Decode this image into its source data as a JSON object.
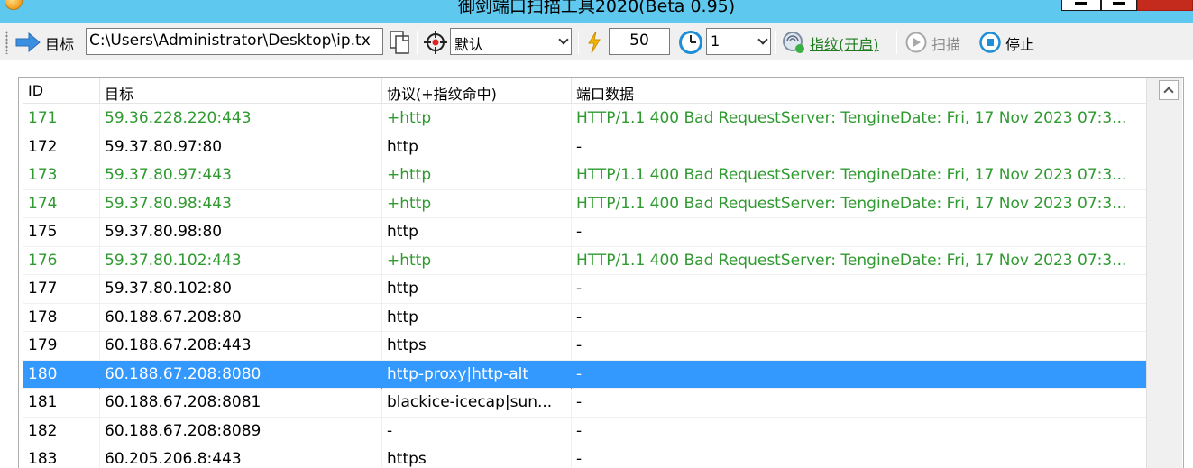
{
  "window": {
    "title": "御剑端口扫描工具2020(Beta 0.95)"
  },
  "toolbar": {
    "target_label": "目标",
    "target_path": "C:\\Users\\Administrator\\Desktop\\ip.tx",
    "profile_selected": "默认",
    "threads_value": "50",
    "timeout_selected": "1",
    "fingerprint_label": "指纹(开启)",
    "scan_label": "扫描",
    "stop_label": "停止"
  },
  "colors": {
    "hit_text": "#2f9a2f",
    "selection": "#3399ff",
    "titlebar": "#5ec8ee"
  },
  "table": {
    "columns": [
      "ID",
      "目标",
      "协议(+指纹命中)",
      "端口数据"
    ],
    "rows": [
      {
        "id": "171",
        "target": "59.36.228.220:443",
        "protocol": "+http",
        "data": "HTTP/1.1 400 Bad RequestServer: TengineDate: Fri, 17 Nov 2023 07:3...",
        "hit": true
      },
      {
        "id": "172",
        "target": "59.37.80.97:80",
        "protocol": "http",
        "data": "-",
        "hit": false
      },
      {
        "id": "173",
        "target": "59.37.80.97:443",
        "protocol": "+http",
        "data": "HTTP/1.1 400 Bad RequestServer: TengineDate: Fri, 17 Nov 2023 07:3...",
        "hit": true
      },
      {
        "id": "174",
        "target": "59.37.80.98:443",
        "protocol": "+http",
        "data": "HTTP/1.1 400 Bad RequestServer: TengineDate: Fri, 17 Nov 2023 07:3...",
        "hit": true
      },
      {
        "id": "175",
        "target": "59.37.80.98:80",
        "protocol": "http",
        "data": "-",
        "hit": false
      },
      {
        "id": "176",
        "target": "59.37.80.102:443",
        "protocol": "+http",
        "data": "HTTP/1.1 400 Bad RequestServer: TengineDate: Fri, 17 Nov 2023 07:3...",
        "hit": true
      },
      {
        "id": "177",
        "target": "59.37.80.102:80",
        "protocol": "http",
        "data": "-",
        "hit": false
      },
      {
        "id": "178",
        "target": "60.188.67.208:80",
        "protocol": "http",
        "data": "-",
        "hit": false
      },
      {
        "id": "179",
        "target": "60.188.67.208:443",
        "protocol": "https",
        "data": "-",
        "hit": false
      },
      {
        "id": "180",
        "target": "60.188.67.208:8080",
        "protocol": "http-proxy|http-alt",
        "data": "-",
        "hit": false,
        "selected": true
      },
      {
        "id": "181",
        "target": "60.188.67.208:8081",
        "protocol": "blackice-icecap|sun...",
        "data": "-",
        "hit": false
      },
      {
        "id": "182",
        "target": "60.188.67.208:8089",
        "protocol": "-",
        "data": "-",
        "hit": false
      },
      {
        "id": "183",
        "target": "60.205.206.8:443",
        "protocol": "https",
        "data": "-",
        "hit": false
      }
    ]
  }
}
